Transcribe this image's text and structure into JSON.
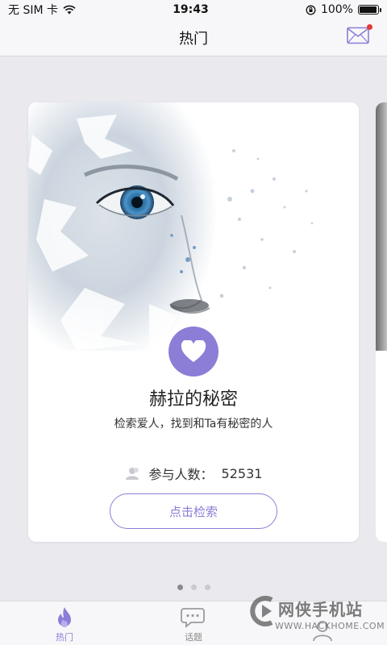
{
  "status_bar": {
    "carrier": "无 SIM 卡",
    "time": "19:43",
    "battery": "100%",
    "battery_level": 1.0
  },
  "nav": {
    "title": "热门",
    "mail_icon": "mail-icon",
    "has_notification": true
  },
  "card": {
    "title": "赫拉的秘密",
    "subtitle": "检索爱人，找到和Ta有秘密的人",
    "participants_label": "参与人数：",
    "participants_count": "52531",
    "search_button": "点击检索",
    "badge_icon": "heart-icon"
  },
  "pager": {
    "pages": 3,
    "current": 1
  },
  "tabs": [
    {
      "label": "热门",
      "icon": "flame-icon",
      "active": true
    },
    {
      "label": "话题",
      "icon": "chat-icon",
      "active": false
    },
    {
      "label": "",
      "icon": "person-icon",
      "active": false
    }
  ],
  "watermark": {
    "brand": "网侠手机站",
    "url": "WWW.HACKHOME.COM"
  },
  "colors": {
    "accent": "#8c7dd6",
    "background": "#e9e9ee",
    "card": "#ffffff",
    "notification": "#e53935"
  }
}
